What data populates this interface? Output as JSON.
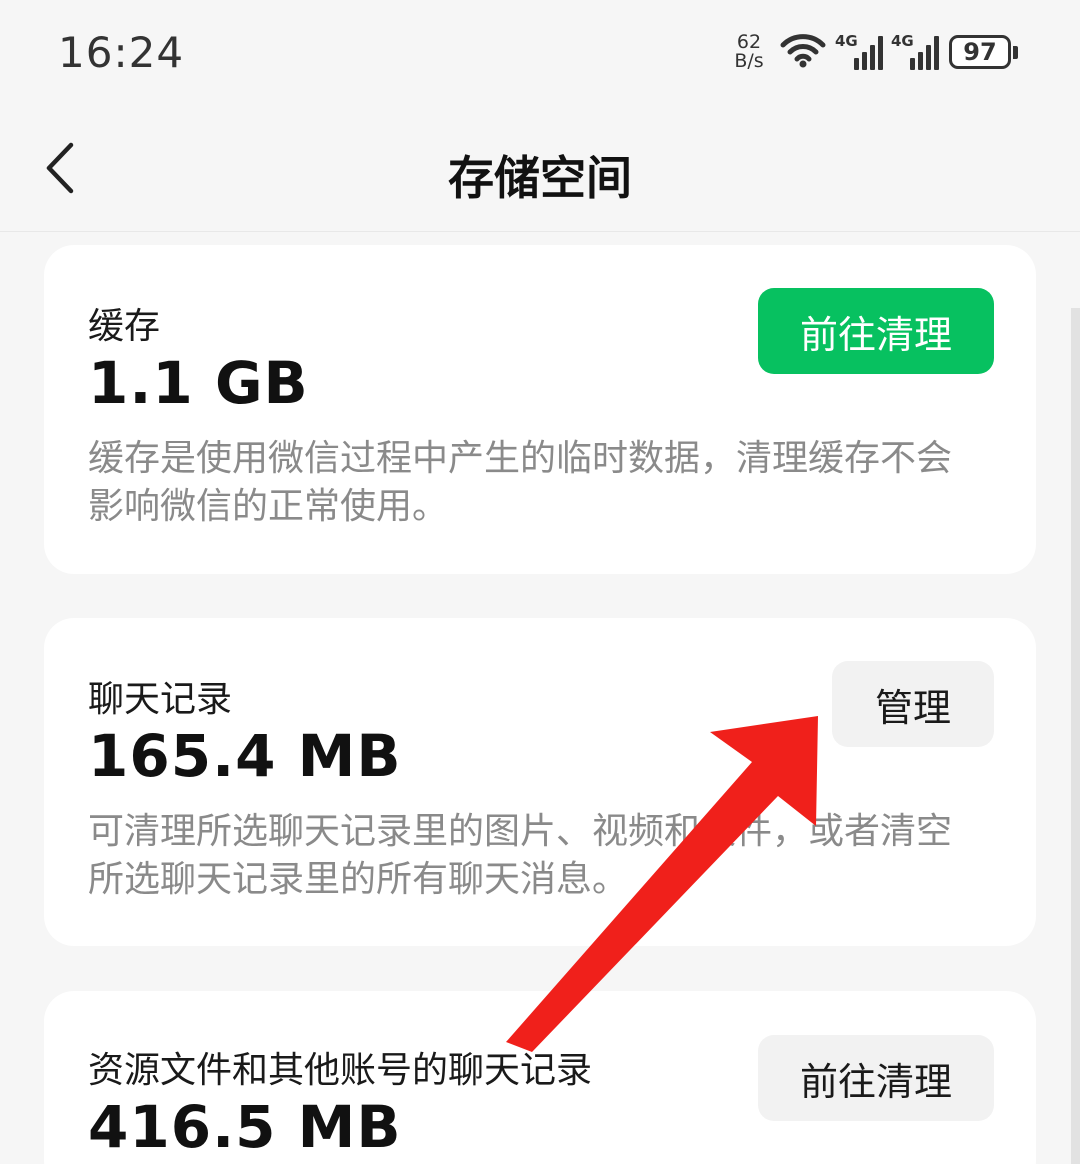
{
  "status_bar": {
    "time": "16:24",
    "net_speed_value": "62",
    "net_speed_unit": "B/s",
    "signal_1_label": "4G",
    "signal_2_label": "4G",
    "battery_level": "97"
  },
  "header": {
    "title": "存储空间"
  },
  "cards": [
    {
      "title": "缓存",
      "size": "1.1 GB",
      "description": "缓存是使用微信过程中产生的临时数据，清理缓存不会影响微信的正常使用。",
      "button_label": "前往清理",
      "button_style": "primary"
    },
    {
      "title": "聊天记录",
      "size": "165.4 MB",
      "description": "可清理所选聊天记录里的图片、视频和文件，或者清空所选聊天记录里的所有聊天消息。",
      "button_label": "管理",
      "button_style": "secondary"
    },
    {
      "title": "资源文件和其他账号的聊天记录",
      "size": "416.5 MB",
      "button_label": "前往清理",
      "button_style": "secondary"
    }
  ],
  "colors": {
    "primary_green": "#07c160",
    "annotation_arrow": "#f0201b",
    "background": "#f6f6f6"
  },
  "icons": {
    "back": "chevron-left-icon",
    "wifi": "wifi-icon",
    "signal": "cellular-signal-icon",
    "battery": "battery-icon"
  }
}
